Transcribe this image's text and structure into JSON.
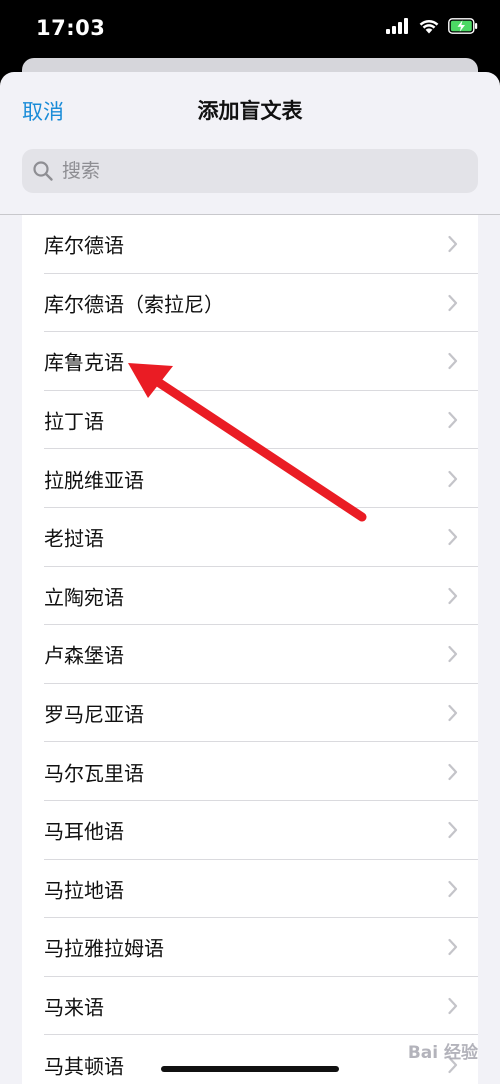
{
  "status_bar": {
    "time": "17:03",
    "icons": [
      "cellular-signal-icon",
      "wifi-icon",
      "battery-charging-icon"
    ]
  },
  "nav": {
    "cancel_label": "取消",
    "title": "添加盲文表"
  },
  "search": {
    "placeholder": "搜索",
    "icon": "magnifier-icon"
  },
  "languages": [
    "库尔德语",
    "库尔德语（索拉尼）",
    "库鲁克语",
    "拉丁语",
    "拉脱维亚语",
    "老挝语",
    "立陶宛语",
    "卢森堡语",
    "罗马尼亚语",
    "马尔瓦里语",
    "马耳他语",
    "马拉地语",
    "马拉雅拉姆语",
    "马来语",
    "马其顿语"
  ],
  "annotation": {
    "type": "red-arrow",
    "color": "#ea1c24",
    "points_to": "库鲁克语"
  },
  "watermark": {
    "text": "Bai 经验"
  },
  "colors": {
    "accent": "#1a8cd8",
    "sheet_background": "#f2f2f7",
    "search_background": "#e3e3e8"
  }
}
